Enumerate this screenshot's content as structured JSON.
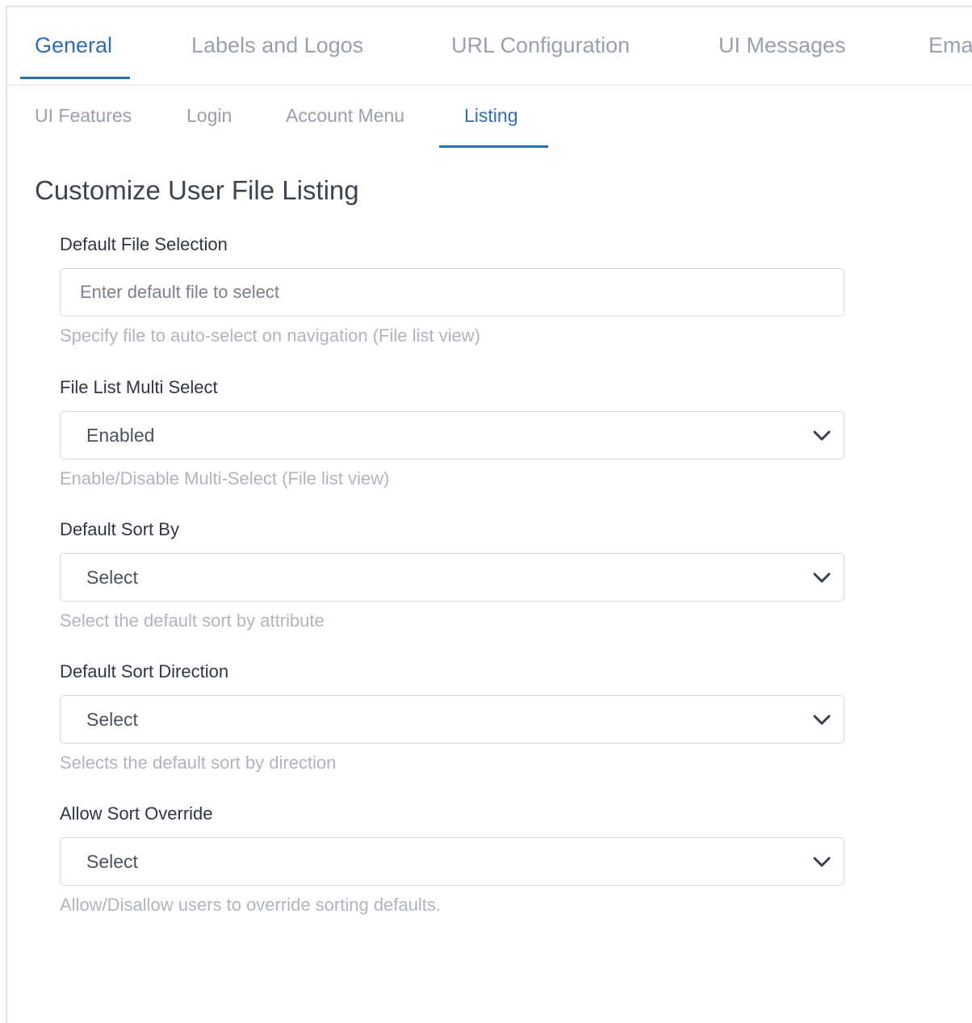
{
  "tabs_primary": [
    {
      "label": "General",
      "active": true
    },
    {
      "label": "Labels and Logos",
      "active": false
    },
    {
      "label": "URL Configuration",
      "active": false
    },
    {
      "label": "UI Messages",
      "active": false
    },
    {
      "label": "Ema",
      "active": false
    }
  ],
  "tabs_secondary": [
    {
      "label": "UI Features",
      "active": false
    },
    {
      "label": "Login",
      "active": false
    },
    {
      "label": "Account Menu",
      "active": false
    },
    {
      "label": "Listing",
      "active": true
    }
  ],
  "page_title": "Customize User File Listing",
  "fields": {
    "default_file_selection": {
      "label": "Default File Selection",
      "value": "",
      "placeholder": "Enter default file to select",
      "help": "Specify file to auto-select on navigation (File list view)"
    },
    "file_list_multi_select": {
      "label": "File List Multi Select",
      "value": "Enabled",
      "help": "Enable/Disable Multi-Select (File list view)"
    },
    "default_sort_by": {
      "label": "Default Sort By",
      "value": "Select",
      "help": "Select the default sort by attribute"
    },
    "default_sort_direction": {
      "label": "Default Sort Direction",
      "value": "Select",
      "help": "Selects the default sort by direction"
    },
    "allow_sort_override": {
      "label": "Allow Sort Override",
      "value": "Select",
      "help": "Allow/Disallow users to override sorting defaults."
    }
  },
  "colors": {
    "accent": "#2e6db3",
    "muted_text": "#9aa0a8",
    "help_text": "#b0b5bb",
    "border": "#d6d9de"
  },
  "icons": {
    "dropdown": "chevron-down-icon"
  }
}
